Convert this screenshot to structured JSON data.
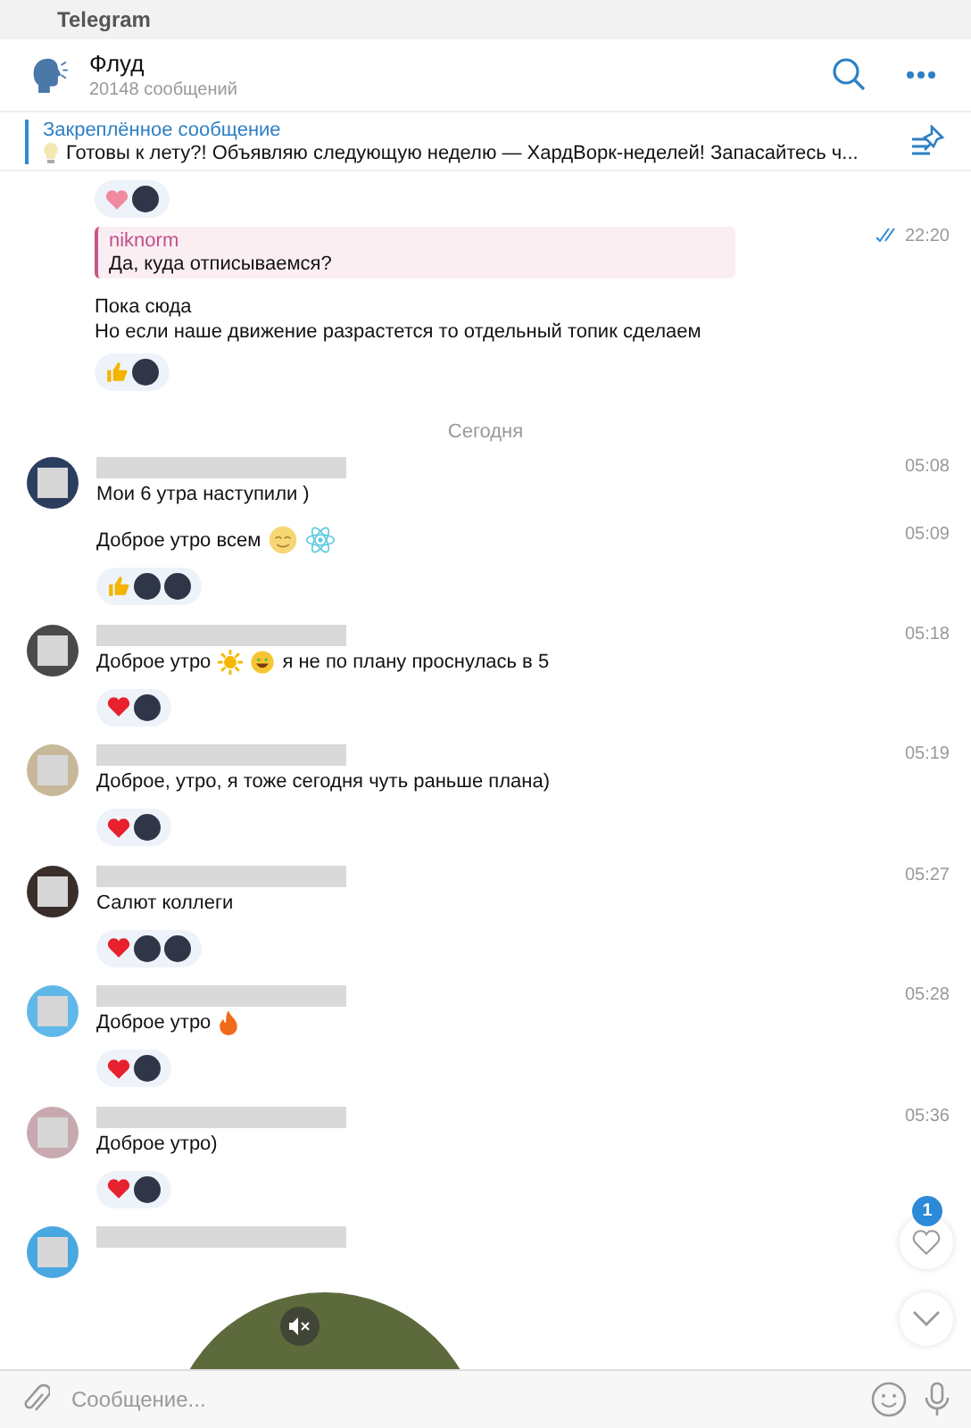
{
  "window": {
    "title": "Telegram"
  },
  "chat": {
    "title": "Флуд",
    "subtitle": "20148 сообщений"
  },
  "pinned": {
    "label": "Закреплённое сообщение",
    "text": "Готовы к лету?!  Объявляю следующую неделю — ХардВорк-неделей!  Запасайтесь ч..."
  },
  "top_reactions": [
    {
      "kind": "heart-pink"
    },
    {
      "kind": "avatar"
    }
  ],
  "own_message": {
    "reply_author": "niknorm",
    "reply_text": "Да, куда отписываемся?",
    "time": "22:20",
    "read": true,
    "lines": [
      "Пока сюда",
      "Но если наше движение разрастется то отдельный топик сделаем"
    ],
    "reactions": [
      {
        "kind": "thumb"
      },
      {
        "kind": "avatar"
      }
    ]
  },
  "date_divider": "Сегодня",
  "groups": [
    {
      "color": "#2c3e60",
      "messages": [
        {
          "time": "05:08",
          "parts": [
            {
              "kind": "text",
              "text": "Мои 6 утра наступили )"
            }
          ]
        },
        {
          "time": "05:09",
          "parts": [
            {
              "kind": "text",
              "text": "Доброе утро всем"
            },
            {
              "kind": "smile"
            },
            {
              "kind": "atom"
            }
          ],
          "reactions": [
            {
              "kind": "thumb"
            },
            {
              "kind": "avatar"
            },
            {
              "kind": "avatar"
            }
          ]
        }
      ]
    },
    {
      "color": "#4a4a4a",
      "messages": [
        {
          "time": "05:18",
          "parts": [
            {
              "kind": "text",
              "text": "Доброе утро"
            },
            {
              "kind": "sun"
            },
            {
              "kind": "grin"
            },
            {
              "kind": "text",
              "text": "я не по плану проснулась в 5"
            }
          ],
          "reactions": [
            {
              "kind": "heart"
            },
            {
              "kind": "avatar"
            }
          ]
        }
      ]
    },
    {
      "color": "#c8b89a",
      "messages": [
        {
          "time": "05:19",
          "parts": [
            {
              "kind": "text",
              "text": "Доброе, утро, я тоже сегодня чуть раньше плана)"
            }
          ],
          "reactions": [
            {
              "kind": "heart"
            },
            {
              "kind": "avatar"
            }
          ]
        }
      ]
    },
    {
      "color": "#3a2e2a",
      "messages": [
        {
          "time": "05:27",
          "parts": [
            {
              "kind": "text",
              "text": "Салют коллеги"
            }
          ],
          "reactions": [
            {
              "kind": "heart"
            },
            {
              "kind": "avatar"
            },
            {
              "kind": "avatar"
            }
          ]
        }
      ]
    },
    {
      "color": "#5fb8e8",
      "messages": [
        {
          "time": "05:28",
          "parts": [
            {
              "kind": "text",
              "text": "Доброе утро"
            },
            {
              "kind": "fire"
            }
          ],
          "reactions": [
            {
              "kind": "heart"
            },
            {
              "kind": "avatar"
            }
          ]
        }
      ]
    },
    {
      "color": "#c9a9b0",
      "messages": [
        {
          "time": "05:36",
          "parts": [
            {
              "kind": "text",
              "text": "Доброе утро)"
            }
          ],
          "reactions": [
            {
              "kind": "heart"
            },
            {
              "kind": "avatar"
            }
          ]
        }
      ]
    }
  ],
  "video_group": {
    "color": "#4aa8e0"
  },
  "reactions_badge": "1",
  "composer": {
    "placeholder": "Сообщение..."
  }
}
